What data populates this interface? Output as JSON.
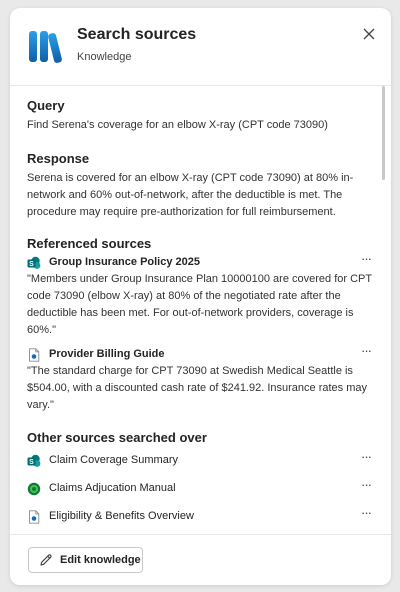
{
  "header": {
    "title": "Search sources",
    "subtitle": "Knowledge",
    "close_icon": "close-icon"
  },
  "query": {
    "heading": "Query",
    "text": "Find Serena's coverage for an elbow X-ray (CPT code 73090)"
  },
  "response": {
    "heading": "Response",
    "text": "Serena is covered for an elbow X-ray (CPT code 73090) at 80% in-network and 60% out-of-network, after the deductible is met. The procedure may require pre-authorization for full reimbursement."
  },
  "referenced": {
    "heading": "Referenced sources",
    "items": [
      {
        "title": "Group Insurance Policy 2025",
        "icon": "sharepoint-icon",
        "excerpt": "\"Members under Group Insurance Plan 10000100 are covered for CPT code 73090 (elbow X-ray) at 80% of the negotiated rate after the deductible has been met. For out-of-network providers, coverage is 60%.\""
      },
      {
        "title": "Provider Billing Guide",
        "icon": "document-icon",
        "excerpt": "\"The standard charge for CPT 73090 at Swedish Medical Seattle is $504.00, with a discounted cash rate of $241.92. Insurance rates may vary.\""
      }
    ]
  },
  "other": {
    "heading": "Other sources searched over",
    "items": [
      {
        "title": "Claim Coverage Summary",
        "icon": "sharepoint-icon"
      },
      {
        "title": "Claims Adjucation Manual",
        "icon": "dataverse-icon"
      },
      {
        "title": "Eligibility & Benefits Overview",
        "icon": "document-icon"
      }
    ]
  },
  "footer": {
    "edit_label": "Edit knowledge"
  },
  "more_label": "···",
  "colors": {
    "accent": "#0f6cbd",
    "sharepoint": "#038387",
    "dataverse": "#13a10e"
  }
}
